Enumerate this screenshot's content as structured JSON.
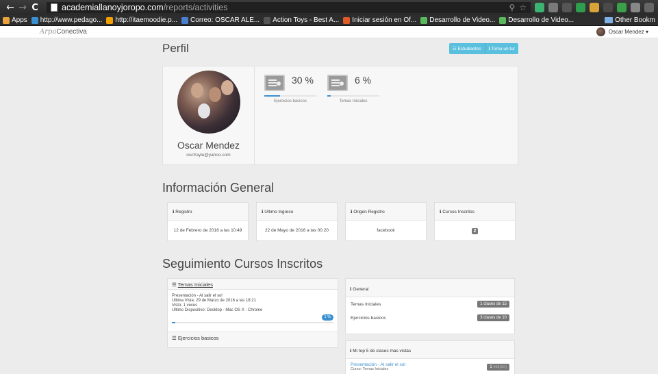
{
  "browser": {
    "url_host": "academiallanoyjoropo.com",
    "url_path": "/reports/activities",
    "bookmarks": [
      {
        "label": "Apps",
        "color": "#e8a33c"
      },
      {
        "label": "http://www.pedago...",
        "color": "#3a8fd0"
      },
      {
        "label": "http://itaemoodie.p...",
        "color": "#f0a000"
      },
      {
        "label": "Correo: OSCAR ALE...",
        "color": "#4a7fd0"
      },
      {
        "label": "Action Toys - Best A...",
        "color": "#555555"
      },
      {
        "label": "Iniciar sesión en Of...",
        "color": "#e05a2a"
      },
      {
        "label": "Desarrollo de Video...",
        "color": "#5cb85c"
      },
      {
        "label": "Desarrollo de Video...",
        "color": "#5cb85c"
      }
    ],
    "other_bookmarks": "Other Bookm"
  },
  "header": {
    "brand_script": "Arpa",
    "brand": "Conectiva",
    "user_name": "Oscar Mendez ▾"
  },
  "perfil": {
    "title": "Perfil",
    "btn_students": "☷ Estudiantes",
    "btn_tour": "ℹ Toma un tur",
    "name": "Oscar Mendez",
    "email": "oscfrayle@yahoo.com",
    "stats": [
      {
        "pct": "30 %",
        "value": 30,
        "label": "Ejercicios basicos"
      },
      {
        "pct": "6 %",
        "value": 6,
        "label": "Temas Iniciales"
      }
    ]
  },
  "info": {
    "title": "Información General",
    "cards": [
      {
        "header": "ℹ Registro",
        "value": "12 de Febrero de 2016 a las 10:49"
      },
      {
        "header": "ℹ Ultimo Ingreso",
        "value": "22 de Mayo de 2016 a las 00:20"
      },
      {
        "header": "ℹ Origen Registro",
        "value": "facebook"
      },
      {
        "header": "ℹ Cursos Inscritos",
        "value": "2"
      }
    ]
  },
  "tracking": {
    "title": "Seguimiento Cursos Inscritos",
    "course1": {
      "name": "Temas Iniciales",
      "lines": [
        "Presentación - Al salir el sol",
        "Ultima Vista: 29 de Marzo de 2016 a las 18:21",
        "Visto: 1 veces",
        "Ultimo Dispositivo: Desktop - Mac OS X - Chrome"
      ],
      "progress_label": "1 %",
      "progress": 1
    },
    "course2": {
      "name": "Ejercicios basicos"
    },
    "general": {
      "header": "ℹ General",
      "rows": [
        {
          "label": "Temas Iniciales",
          "value": "1 clases de 15"
        },
        {
          "label": "Ejercicios basicos",
          "value": "3 clases de 10"
        }
      ]
    },
    "top": {
      "header": "ℹ Mi top 5 de clases mas vistas",
      "item_title": "Presentación - Al salir el sol",
      "item_course": "Curso: Temas Iniciales",
      "item_count": "1",
      "item_unit": "vez(es)"
    }
  }
}
